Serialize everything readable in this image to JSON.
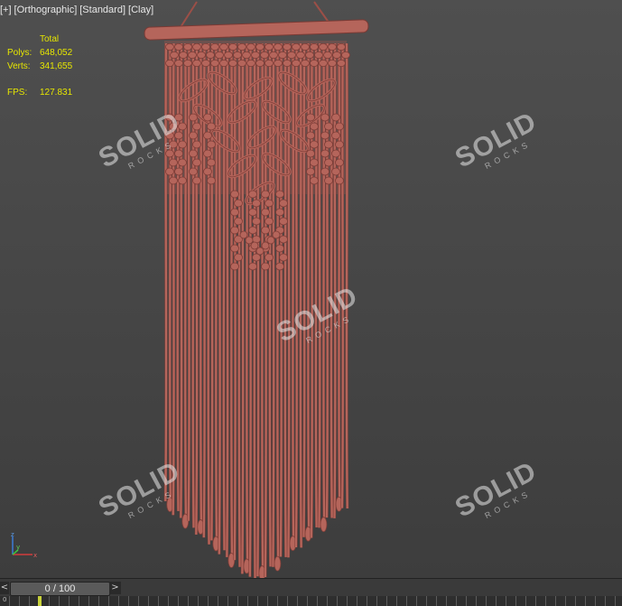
{
  "viewport": {
    "labels": [
      "[+]",
      "[Orthographic]",
      "[Standard]",
      "[Clay]"
    ],
    "stats": {
      "header": "Total",
      "rows": [
        {
          "label": "Polys:",
          "value": "648,052"
        },
        {
          "label": "Verts:",
          "value": "341,655"
        }
      ],
      "fps_label": "FPS:",
      "fps_value": "127.831"
    },
    "model_color": "#b5655b",
    "watermark": {
      "word": "SOLID",
      "sub": "ROCKS"
    },
    "axis": {
      "x": "x",
      "y": "y",
      "z": "z"
    }
  },
  "timeline": {
    "prev_arrow": "<",
    "frame_display": "0 / 100",
    "next_arrow": ">",
    "tick_start": "0"
  }
}
